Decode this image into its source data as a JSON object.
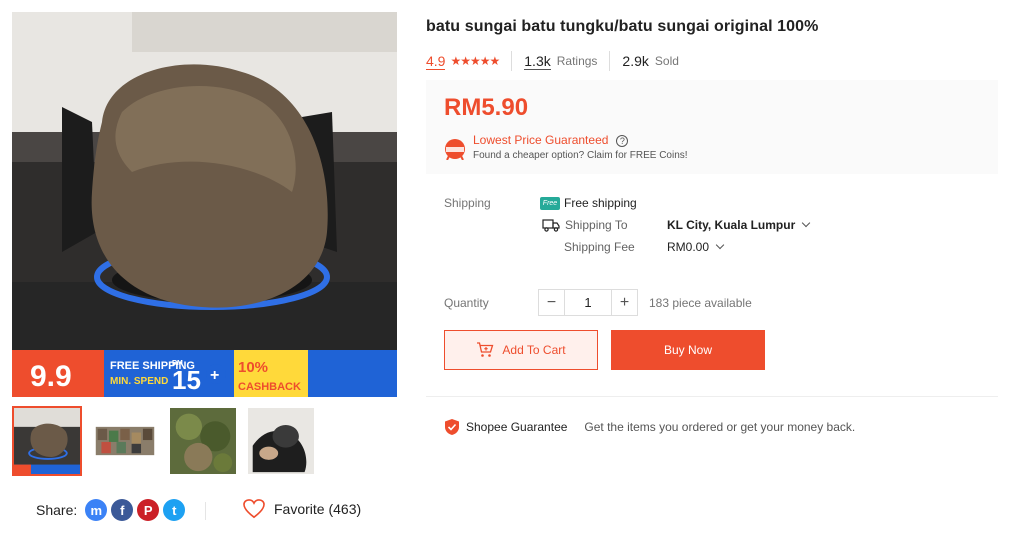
{
  "product": {
    "title": "batu sungai batu tungku/batu sungai original 100%",
    "rating": "4.9",
    "stars": "★★★★★",
    "ratings_count": "1.3k",
    "ratings_label": "Ratings",
    "sold_count": "2.9k",
    "sold_label": "Sold",
    "price": "RM5.90"
  },
  "lowest_price": {
    "title": "Lowest Price Guaranteed",
    "subtitle": "Found a cheaper option? Claim for FREE Coins!",
    "badge_icon": "lowest-price-badge-icon"
  },
  "shipping": {
    "label": "Shipping",
    "free_tag": "Free",
    "free_text": "Free shipping",
    "to_label": "Shipping To",
    "to_value": "KL City, Kuala Lumpur",
    "fee_label": "Shipping Fee",
    "fee_value": "RM0.00"
  },
  "quantity": {
    "label": "Quantity",
    "value": "1",
    "minus": "−",
    "plus": "+",
    "available": "183 piece available"
  },
  "actions": {
    "add_to_cart": "Add To Cart",
    "buy_now": "Buy Now"
  },
  "guarantee": {
    "title": "Shopee Guarantee",
    "text": "Get the items you ordered or get your money back."
  },
  "promo_banner": {
    "sale": "9.9",
    "free_shipping": "FREE SHIPPING",
    "min_spend": "MIN. SPEND",
    "rm": "RM",
    "amount": "15",
    "cashback_pct": "10%",
    "cashback": "CASHBACK"
  },
  "share": {
    "label": "Share:",
    "messenger": "m",
    "facebook": "f",
    "pinterest": "P",
    "twitter": "t"
  },
  "favorite": {
    "label": "Favorite (463)"
  },
  "colors": {
    "brand": "#ee4d2d",
    "teal": "#26aa99"
  }
}
